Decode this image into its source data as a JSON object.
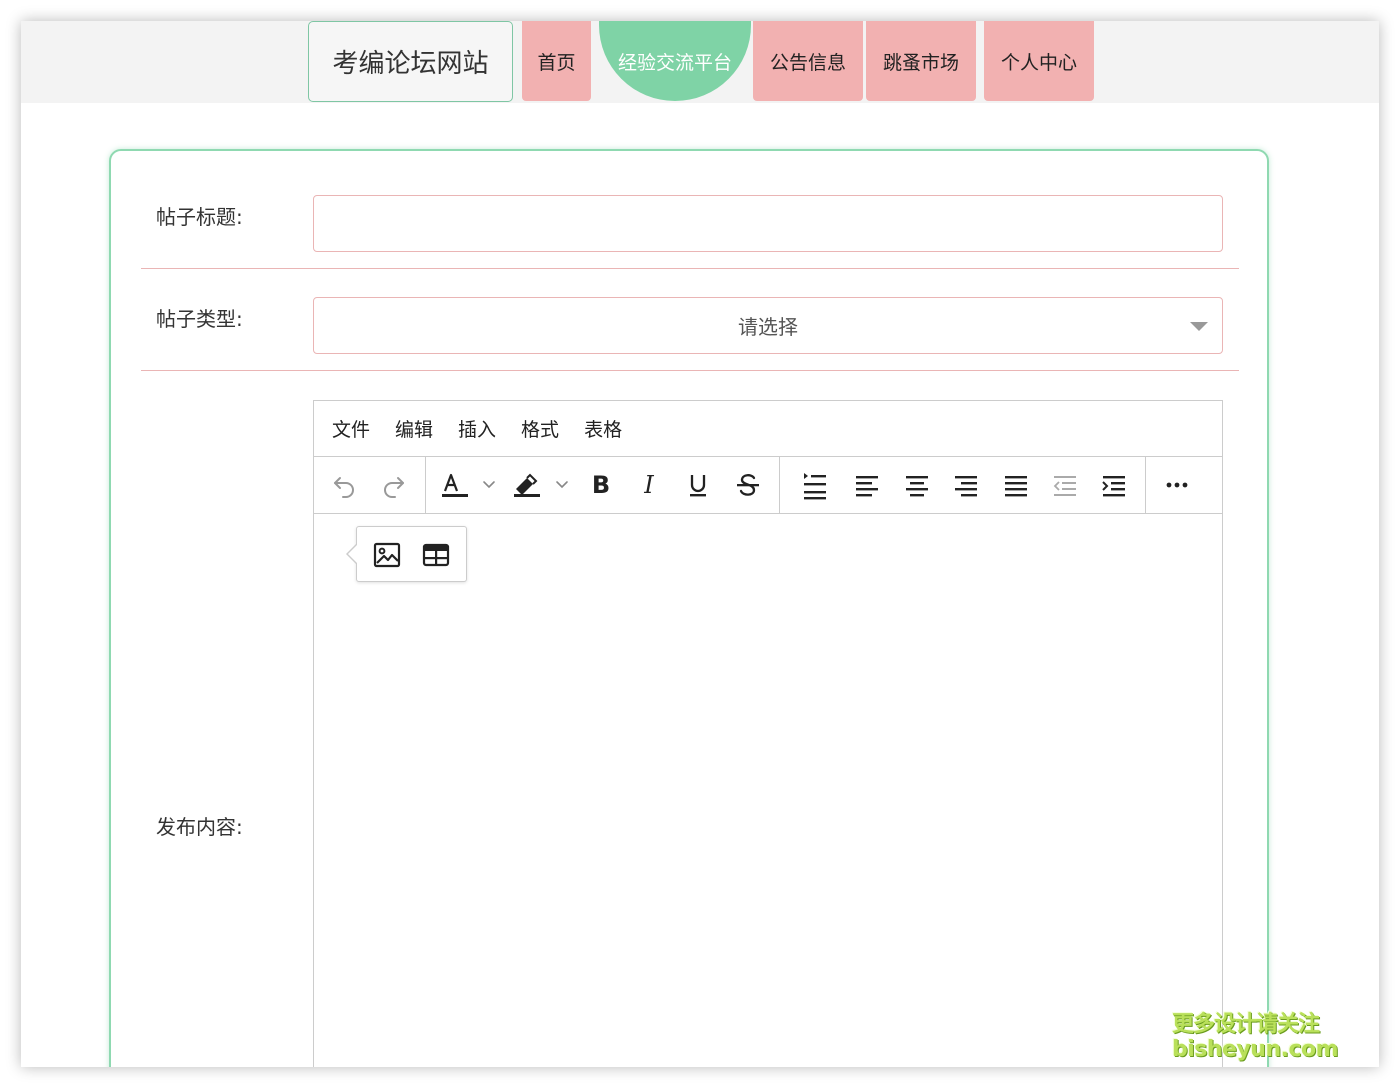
{
  "nav": {
    "brand": "考编论坛网站",
    "items": [
      "首页",
      "经验交流平台",
      "公告信息",
      "跳蚤市场",
      "个人中心"
    ],
    "active_index": 1
  },
  "form": {
    "title_label": "帖子标题:",
    "title_value": "",
    "type_label": "帖子类型:",
    "type_placeholder": "请选择",
    "content_label": "发布内容:"
  },
  "editor": {
    "menu": [
      "文件",
      "编辑",
      "插入",
      "格式",
      "表格"
    ],
    "toolbar_icons": [
      "undo-icon",
      "redo-icon",
      "text-color-icon",
      "highlight-icon",
      "bold-icon",
      "italic-icon",
      "underline-icon",
      "strikethrough-icon",
      "line-height-icon",
      "align-left-icon",
      "align-center-icon",
      "align-right-icon",
      "align-justify-icon",
      "outdent-icon",
      "indent-icon",
      "more-icon"
    ],
    "bold_glyph": "B",
    "italic_glyph": "I",
    "underline_glyph": "U",
    "strike_glyph": "S",
    "popup_icons": [
      "image-icon",
      "table-icon"
    ]
  },
  "watermark": {
    "line1": "更多设计请关注",
    "line2": "bisheyun.com"
  },
  "colors": {
    "nav_pink": "#f2b1b1",
    "nav_active_green": "#7fd3a6",
    "card_border": "#8fd9b1",
    "field_border": "#eab5b5"
  }
}
